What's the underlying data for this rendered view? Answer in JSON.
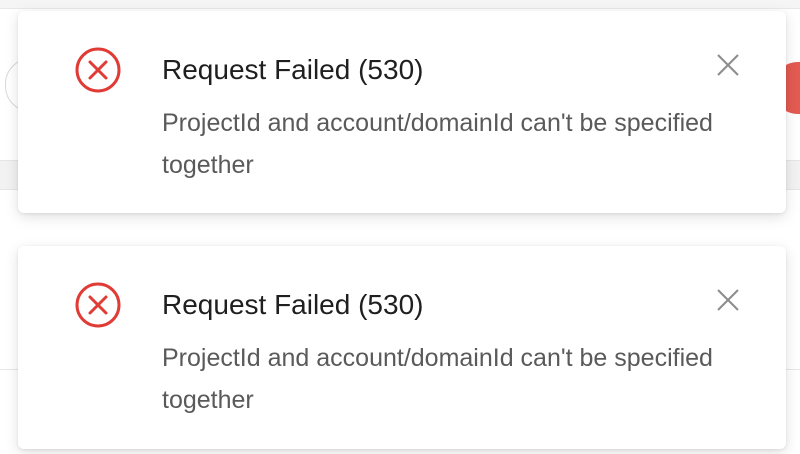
{
  "colors": {
    "error": "#e03c35",
    "title": "#1f1f1f",
    "message": "#5a5a5a",
    "close": "#8c8c8c"
  },
  "notifications": [
    {
      "icon": "close-circle-icon",
      "title": "Request Failed (530)",
      "message": "ProjectId and account/domainId can't be specified together"
    },
    {
      "icon": "close-circle-icon",
      "title": "Request Failed (530)",
      "message": "ProjectId and account/domainId can't be specified together"
    }
  ]
}
